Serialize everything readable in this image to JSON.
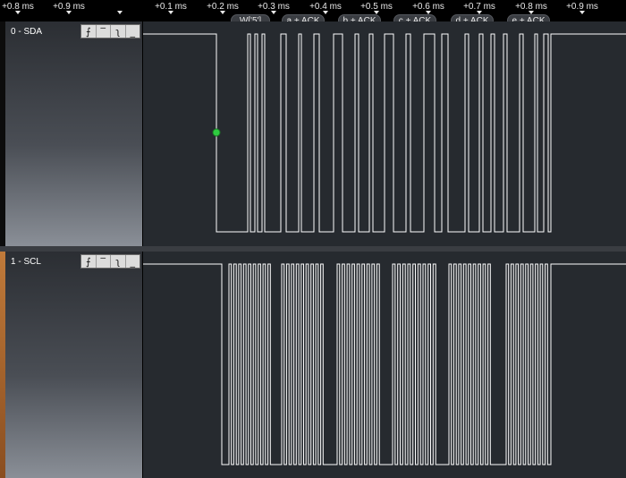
{
  "timeline": {
    "ticks": [
      "+0.8 ms",
      "+0.9 ms",
      "+0.1 ms",
      "+0.2 ms",
      "+0.3 ms",
      "+0.4 ms",
      "+0.5 ms",
      "+0.6 ms",
      "+0.7 ms",
      "+0.8 ms",
      "+0.9 ms"
    ]
  },
  "protocol": {
    "frames": [
      "W['5']",
      "a + ACK",
      "b + ACK",
      "c + ACK",
      "d + ACK",
      "e + ACK"
    ]
  },
  "channels": [
    {
      "label": "0 - SDA",
      "accent": "#2a2a2a",
      "trigger_buttons": [
        "rising-edge-icon",
        "high-level-icon",
        "falling-edge-icon",
        "low-level-icon"
      ]
    },
    {
      "label": "1 - SCL",
      "accent": "#b0713a",
      "trigger_buttons": [
        "rising-edge-icon",
        "high-level-icon",
        "falling-edge-icon",
        "low-level-icon"
      ]
    }
  ],
  "colors": {
    "trace": "#ffffff",
    "marker": "#2ecc40",
    "background": "#262a2f"
  }
}
